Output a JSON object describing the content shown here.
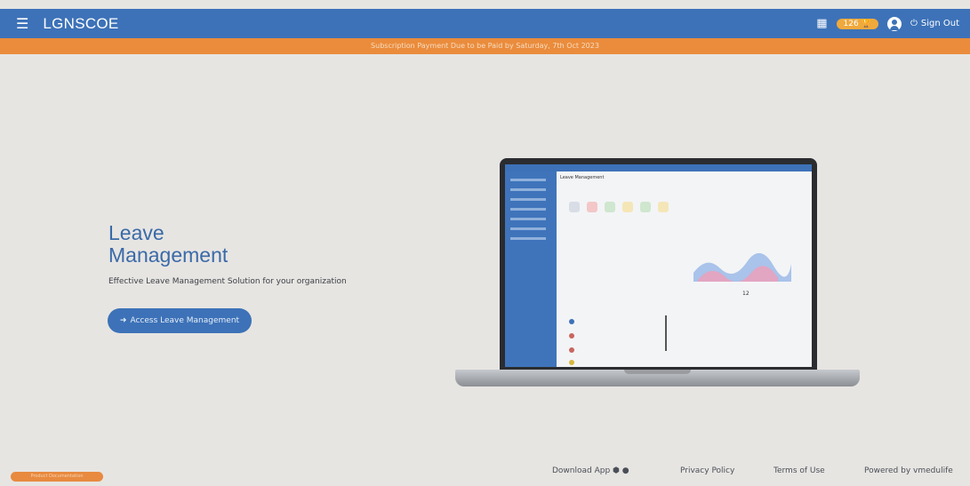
{
  "header": {
    "brand": "LGNSCOE",
    "badge_count": "126",
    "sign_out": "Sign Out"
  },
  "notice": "Subscription Payment Due to be Paid by Saturday, 7th Oct 2023",
  "hero": {
    "title_line1": "Leave",
    "title_line2": "Management",
    "subtitle": "Effective Leave Management Solution for your organization",
    "cta_label": "Access Leave Management"
  },
  "screen": {
    "title": "Leave Management",
    "value": "12"
  },
  "footer": {
    "pill": "Product Documentation",
    "download": "Download App",
    "privacy": "Privacy Policy",
    "terms": "Terms of Use",
    "powered": "Powered by vmedulife"
  },
  "colors": {
    "primary": "#3d72b8",
    "accent": "#ea8c3c"
  }
}
